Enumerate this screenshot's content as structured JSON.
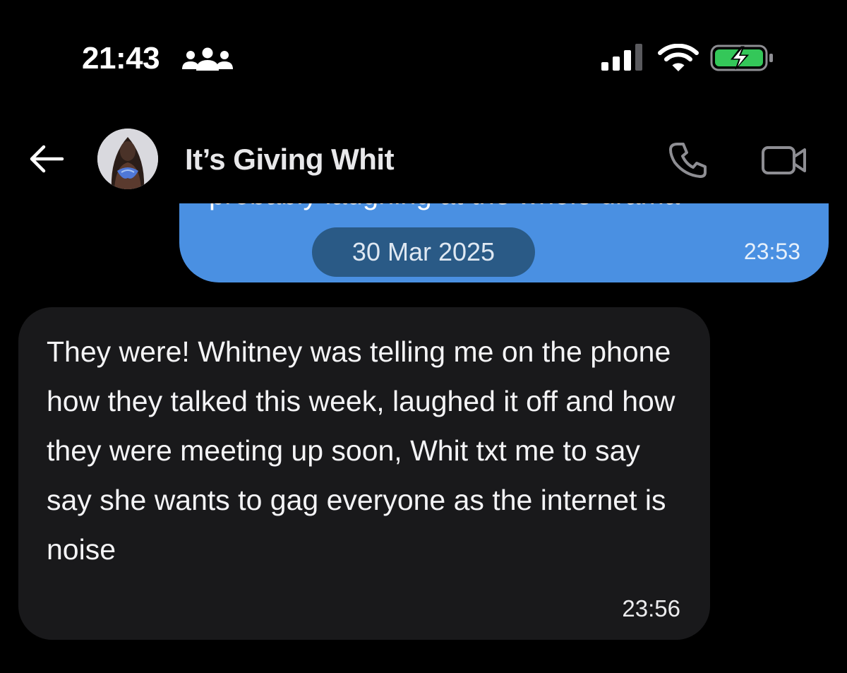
{
  "status_bar": {
    "time": "21:43",
    "icons": [
      "people-icon",
      "signal-icon",
      "wifi-icon",
      "battery-charging-icon"
    ],
    "battery_color": "#34c759"
  },
  "header": {
    "back_icon": "back-arrow-icon",
    "contact_name": "It’s Giving Whit",
    "call_icon": "phone-icon",
    "video_icon": "video-camera-icon"
  },
  "messages": [
    {
      "direction": "outgoing",
      "text_partial": "probably laughing at the whole drama",
      "date": "30 Mar 2025",
      "time": "23:53",
      "bubble_color": "#4a90e2"
    },
    {
      "direction": "incoming",
      "text": "They were! Whitney was telling me on the phone how they talked this week, laughed it off and how they were meeting up soon, Whit txt me to say say she wants to gag everyone as the internet is noise",
      "time": "23:56",
      "bubble_color": "#19191b"
    }
  ]
}
